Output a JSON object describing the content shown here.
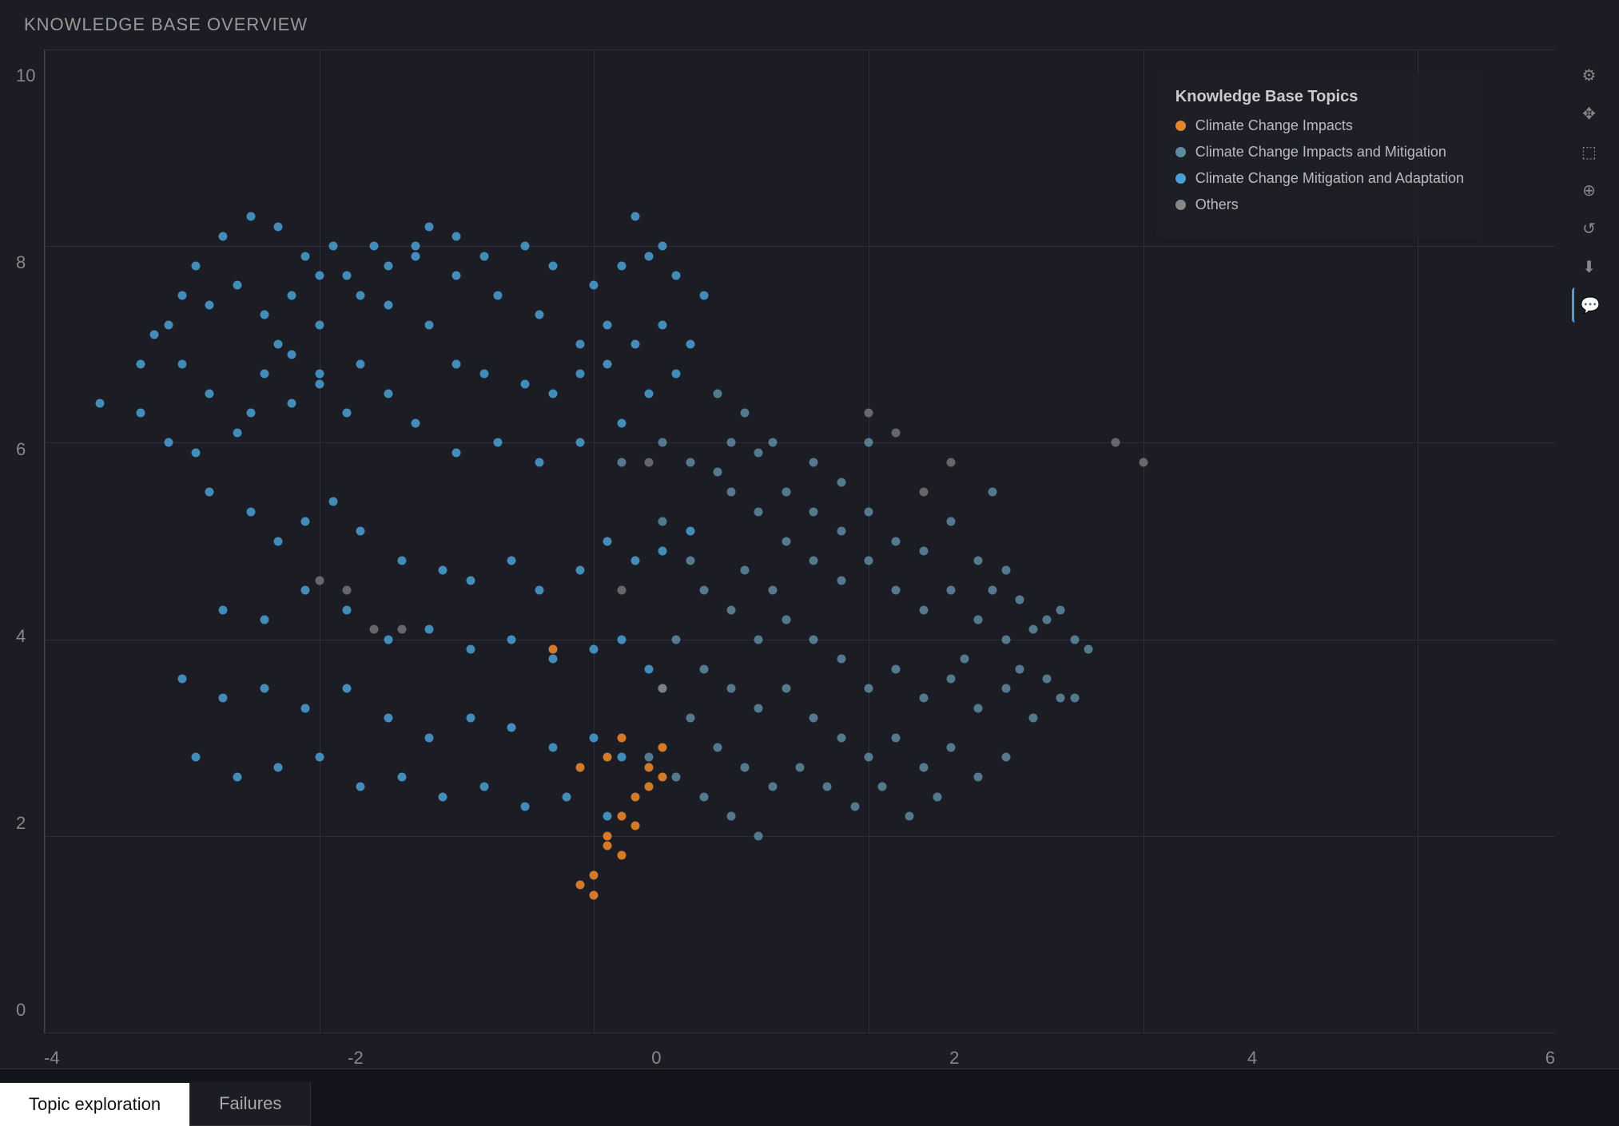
{
  "title": "KNOWLEDGE BASE OVERVIEW",
  "yAxis": {
    "labels": [
      "0",
      "2",
      "4",
      "6",
      "8",
      "10"
    ]
  },
  "xAxis": {
    "labels": [
      "-4",
      "-2",
      "0",
      "2",
      "4",
      "6"
    ]
  },
  "legend": {
    "title": "Knowledge Base Topics",
    "items": [
      {
        "label": "Climate Change Impacts",
        "color": "#e8852a",
        "type": "orange"
      },
      {
        "label": "Climate Change Impacts and Mitigation",
        "color": "#7ab8d4",
        "type": "light-blue"
      },
      {
        "label": "Climate Change Mitigation and Adaptation",
        "color": "#4a9fd4",
        "type": "blue"
      },
      {
        "label": "Others",
        "color": "#888",
        "type": "gray"
      }
    ]
  },
  "tabs": [
    {
      "label": "Topic exploration",
      "active": true
    },
    {
      "label": "Failures",
      "active": false
    }
  ],
  "toolbar": {
    "buttons": [
      {
        "icon": "⚙",
        "name": "settings",
        "active": false
      },
      {
        "icon": "✥",
        "name": "move",
        "active": false
      },
      {
        "icon": "⬚",
        "name": "select-region",
        "active": false
      },
      {
        "icon": "⊕",
        "name": "zoom-in",
        "active": false
      },
      {
        "icon": "↺",
        "name": "reset",
        "active": false
      },
      {
        "icon": "⬇",
        "name": "download",
        "active": false
      },
      {
        "icon": "💬",
        "name": "chat",
        "active": true
      }
    ]
  }
}
